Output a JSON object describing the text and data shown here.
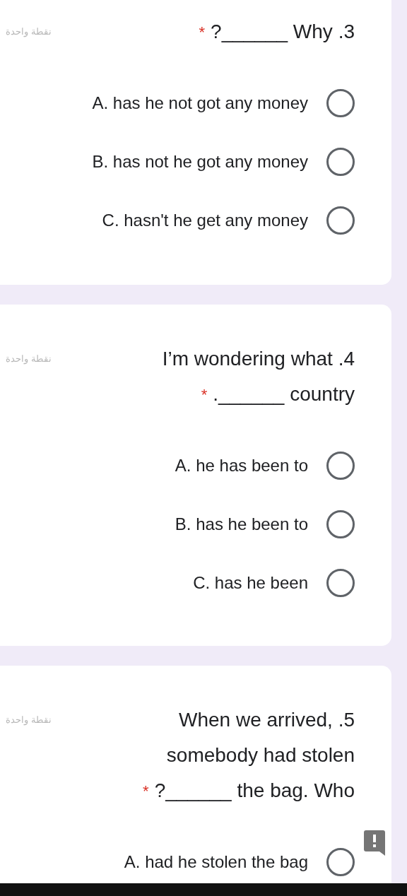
{
  "questions": [
    {
      "points": "نقطة واحدة",
      "lines": [
        "?______ Why .3"
      ],
      "required_mark": "*",
      "options": [
        {
          "label": "A. has he not got any money",
          "selected": false
        },
        {
          "label": "B. has not he got any money",
          "selected": false
        },
        {
          "label": "C. hasn't he get any money",
          "selected": false
        }
      ]
    },
    {
      "points": "نقطة واحدة",
      "lines": [
        "I’m wondering what .4",
        ".______ country"
      ],
      "required_mark": "*",
      "options": [
        {
          "label": "A. he has been to",
          "selected": false
        },
        {
          "label": "B. has he been to",
          "selected": false
        },
        {
          "label": "C. has he been",
          "selected": false
        }
      ]
    },
    {
      "points": "نقطة واحدة",
      "lines": [
        "When we arrived, .5",
        "somebody had stolen",
        "?______ the bag. Who"
      ],
      "required_mark": "*",
      "options": [
        {
          "label": "A. had he stolen the bag",
          "selected": false
        }
      ]
    }
  ]
}
